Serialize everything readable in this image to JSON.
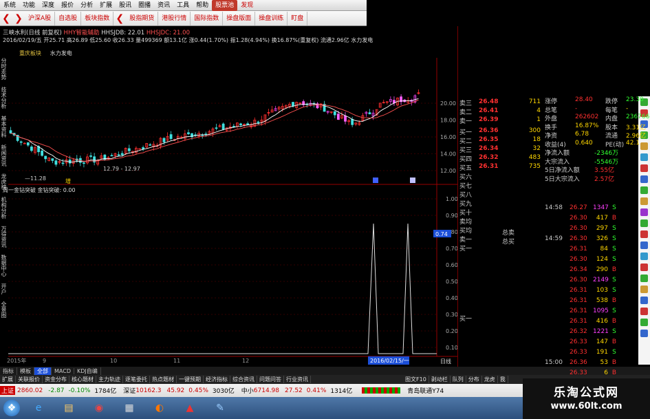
{
  "menubar": {
    "items": [
      "系统",
      "功能",
      "深度",
      "报价",
      "分析",
      "扩展",
      "股讯",
      "圈播",
      "资讯",
      "工具",
      "帮助",
      "股票池",
      "发现"
    ],
    "active_index": 11
  },
  "toolbar": {
    "items": [
      "沪深A股",
      "自选股",
      "板块指数",
      "股指期货",
      "港股行情",
      "国际指数",
      "操盘版面",
      "操盘训练",
      "盯盘"
    ]
  },
  "info": {
    "line1_stock": "三峡水利(日线 前复权)",
    "line1_ind": "HHY智能辅助",
    "line1_v1": "HHSJDB: 22.01",
    "line1_v2": "HHSJDC: 21.00",
    "line2": "2016/02/19/五 开25.71 高26.89 低25.60 收26.33 量499369 额13.1亿 涨0.44(1.70%) 振1.28(4.94%) 换16.87%(重复权) 流通2.96亿 水力发电",
    "line3_a": "重庆板块",
    "line3_b": "水力发电"
  },
  "chart_data": {
    "type": "candlestick",
    "y_ticks": [
      "20.00",
      "18.00",
      "16.00",
      "14.00",
      "12.00"
    ],
    "annotations": [
      "11.28",
      "12.79 - 12.97",
      "增"
    ],
    "x_labels": [
      "2015年",
      "9",
      "10",
      "11",
      "12",
      "2016/02/15/一"
    ],
    "indicator_title": "周一金钻突破 金钻突破: 0.00",
    "indicator_ticks": [
      "1.00",
      "0.90",
      "0.80",
      "0.70",
      "0.60",
      "0.50",
      "0.40",
      "0.30",
      "0.20",
      "0.10"
    ],
    "indicator_value_label": "0.74",
    "period_label": "日线"
  },
  "left_tabs": [
    "分时走势",
    "技术分析",
    "基本资料",
    "新闻资讯",
    "龙虎榜",
    "机构分析",
    "万得资讯",
    "数据中心",
    "开户",
    "全景图"
  ],
  "quote": {
    "sell": [
      {
        "label": "卖三",
        "price": "26.48",
        "vol": "711"
      },
      {
        "label": "卖二",
        "price": "26.41",
        "vol": "4"
      },
      {
        "label": "卖一",
        "price": "26.39",
        "vol": "1"
      }
    ],
    "buy": [
      {
        "label": "买一",
        "price": "26.36",
        "vol": "300"
      },
      {
        "label": "买二",
        "price": "26.35",
        "vol": "18"
      },
      {
        "label": "买三",
        "price": "26.34",
        "vol": "32"
      },
      {
        "label": "买四",
        "price": "26.32",
        "vol": "483"
      },
      {
        "label": "买五",
        "price": "26.31",
        "vol": "735"
      }
    ],
    "extra_labels": [
      "买六",
      "买七",
      "买八",
      "买九",
      "买十",
      "卖均",
      "买均",
      "卖一",
      "买一"
    ],
    "total_sell": "总卖",
    "total_buy": "总买",
    "stats": [
      [
        "涨停",
        "28.40",
        "跌停",
        "23.30"
      ],
      [
        "总笔",
        "-",
        "每笔",
        "-"
      ],
      [
        "外盘",
        "262602",
        "内盘",
        "236766"
      ],
      [
        "换手",
        "16.87%",
        "股本",
        "3.31亿"
      ],
      [
        "净资",
        "6.78",
        "流通",
        "2.96亿"
      ],
      [
        "收益(4)",
        "0.640",
        "PE(动)",
        "42.1"
      ],
      [
        "净流入额",
        "-2346万",
        "",
        ""
      ],
      [
        "大宗流入",
        "-5546万",
        "",
        ""
      ],
      [
        "5日净流入额",
        "3.55亿",
        "",
        ""
      ],
      [
        "5日大宗流入",
        "2.57亿",
        "",
        ""
      ]
    ],
    "ticks": [
      {
        "t": "14:58",
        "p": "26.27",
        "v": "1347",
        "s": "S"
      },
      {
        "t": "",
        "p": "26.30",
        "v": "417",
        "s": "B"
      },
      {
        "t": "",
        "p": "26.30",
        "v": "297",
        "s": "S"
      },
      {
        "t": "14:59",
        "p": "26.30",
        "v": "326",
        "s": "S"
      },
      {
        "t": "",
        "p": "26.31",
        "v": "84",
        "s": "S"
      },
      {
        "t": "",
        "p": "26.30",
        "v": "124",
        "s": "S"
      },
      {
        "t": "",
        "p": "26.34",
        "v": "290",
        "s": "B"
      },
      {
        "t": "",
        "p": "26.30",
        "v": "2149",
        "s": "S"
      },
      {
        "t": "",
        "p": "26.31",
        "v": "103",
        "s": "S"
      },
      {
        "t": "",
        "p": "26.31",
        "v": "538",
        "s": "B"
      },
      {
        "t": "",
        "p": "26.31",
        "v": "1095",
        "s": "S"
      },
      {
        "t": "",
        "p": "26.31",
        "v": "416",
        "s": "B"
      },
      {
        "t": "",
        "p": "26.32",
        "v": "1221",
        "s": "S"
      },
      {
        "t": "",
        "p": "26.33",
        "v": "147",
        "s": "B"
      },
      {
        "t": "",
        "p": "26.33",
        "v": "191",
        "s": "S"
      },
      {
        "t": "15:00",
        "p": "26.36",
        "v": "53",
        "s": "B"
      },
      {
        "t": "",
        "p": "26.33",
        "v": "6",
        "s": "B"
      }
    ]
  },
  "bottom_tabs": [
    "指标",
    "模板",
    "全部",
    "MACD",
    "KDJ自编"
  ],
  "bottom_links": [
    "扩展",
    "关联报价",
    "资金分布",
    "核心题材",
    "主力轨迹",
    "逐笔委托",
    "热点题材",
    "一键预期",
    "经济指标",
    "综合资讯",
    "问题问答",
    "行业资讯",
    "图文F10",
    "剥动栏",
    "队列",
    "分布",
    "龙虎",
    "我"
  ],
  "status": {
    "sh_label": "上证",
    "sh_val": "2860.02",
    "sh_chg": "-2.87",
    "sh_pct": "-0.10%",
    "sh_amt": "1784亿",
    "sz_label": "深证",
    "sz_val": "10162.3",
    "sz_chg": "45.92",
    "sz_pct": "0.45%",
    "sz_amt": "3030亿",
    "zx_label": "中小",
    "zx_val": "6714.98",
    "zx_chg": "27.52",
    "zx_pct": "0.41%",
    "zx_amt": "1314亿",
    "site": "青岛联通Y74"
  },
  "watermark": {
    "line1": "乐淘公式网",
    "line2": "www.60lt.com"
  }
}
